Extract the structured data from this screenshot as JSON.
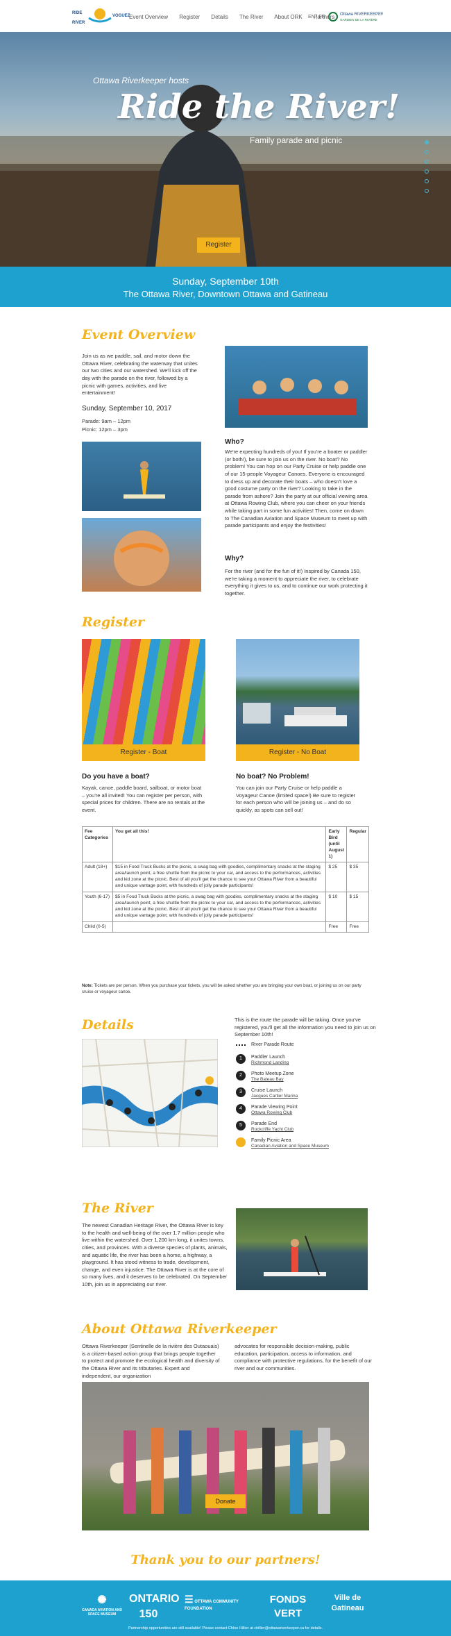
{
  "nav": {
    "logo_text": "RIDE THE RIVER / VOGUEZ SUR LA RIVIÈRE",
    "links": [
      "Event Overview",
      "Register",
      "Details",
      "The River",
      "About ORK",
      "Partners"
    ],
    "lang": "EN | FR",
    "partner_logo": "Ottawa RIVERKEEPER GARDIEN DE LA RIVIÈRE DES OUTAOUAIS"
  },
  "hero": {
    "subtitle": "Ottawa Riverkeeper hosts",
    "title": "Ride the River!",
    "tagline": "Family parade and picnic",
    "button": "Register"
  },
  "dateband": {
    "line1": "Sunday, September 10th",
    "line2": "The Ottawa River, Downtown Ottawa and Gatineau"
  },
  "overview": {
    "heading": "Event Overview",
    "intro": "Join us as we paddle, sail, and motor down the Ottawa River, celebrating the waterway that unites our two cities and our watershed. We'll kick off the day with the parade on the river, followed by a picnic with games, activities, and live entertainment!",
    "date": "Sunday, September 10, 2017",
    "parade": "Parade: 9am – 12pm",
    "picnic": "Picnic: 12pm – 3pm",
    "who_heading": "Who?",
    "who_text": "We're expecting hundreds of you! If you're a boater or paddler (or both!), be sure to join us on the river. No boat? No problem! You can hop on our Party Cruise or help paddle one of our 15-people Voyageur Canoes. Everyone is encouraged to dress up and decorate their boats – who doesn't love a good costume party on the river? Looking to take in the parade from ashore? Join the party at our official viewing area at Ottawa Rowing Club, where you can cheer on your friends while taking part in some fun activities! Then, come on down to The Canadian Aviation and Space Museum to meet up with parade participants and enjoy the festivities!",
    "why_heading": "Why?",
    "why_text": "For the river (and for the fun of it!) Inspired by Canada 150, we're taking a moment to appreciate the river, to celebrate everything it gives to us, and to continue our work protecting it together."
  },
  "register": {
    "heading": "Register",
    "boat_button": "Register - Boat",
    "noboat_button": "Register - No Boat",
    "boat_heading": "Do you have a boat?",
    "boat_text": "Kayak, canoe, paddle board, sailboat, or motor boat – you're all invited! You can register per person, with special prices for children. There are no rentals at the event.",
    "noboat_heading": "No boat? No Problem!",
    "noboat_text": "You can join our Party Cruise or help paddle a Voyageur Canoe (limited space!) Be sure to register for each person who will be joining us – and do so quickly, as spots can sell out!"
  },
  "fees": {
    "headers": [
      "Fee Categories",
      "You get all this!",
      "Early Bird (until August 1)",
      "Regular"
    ],
    "rows": [
      [
        "Adult (18+)",
        "$15 in Food Truck Bucks at the picnic, a swag bag with goodies, complimentary snacks at the staging area/launch point, a free shuttle from the picnic to your car, and access to the performances, activities and kid zone at the picnic. Best of all you'll get the chance to see your Ottawa River from a beautiful and unique vantage point, with hundreds of jolly parade participants!",
        "$ 25",
        "$ 35"
      ],
      [
        "Youth (6-17)",
        "$5 in Food Truck Bucks at the picnic, a swag bag with goodies, complimentary snacks at the staging area/launch point, a free shuttle from the picnic to your car, and access to the performances, activities and kid zone at the picnic. Best of all you'll get the chance to see your Ottawa River from a beautiful and unique vantage point, with hundreds of jolly parade participants!",
        "$ 10",
        "$ 15"
      ],
      [
        "Child (0-5)",
        "",
        "Free",
        "Free"
      ]
    ],
    "note_label": "Note:",
    "note": "Tickets are per person. When you purchase your tickets, you will be asked whether you are bringing your own boat, or joining us on our party cruise or voyageur canoe."
  },
  "details": {
    "heading": "Details",
    "intro": "This is the route the parade will be taking. Once you've registered, you'll get all the information you need to join us on September 10th!",
    "legend_line": "River Parade Route",
    "items": [
      {
        "num": "1",
        "title": "Paddler Launch",
        "place": "Richmond Landing"
      },
      {
        "num": "2",
        "title": "Photo Meetup Zone",
        "place": "The Bateau Bay"
      },
      {
        "num": "3",
        "title": "Cruise Launch",
        "place": "Jacques Cartier Marina"
      },
      {
        "num": "4",
        "title": "Parade Viewing Point",
        "place": "Ottawa Rowing Club"
      },
      {
        "num": "5",
        "title": "Parade End",
        "place": "Rockcliffe Yacht Club"
      },
      {
        "num": "",
        "title": "Family Picnic Area",
        "place": "Canadian Aviation and Space Museum"
      }
    ]
  },
  "river": {
    "heading": "The River",
    "text": "The newest Canadian Heritage River, the Ottawa River is key to the health and well-being of the over 1.7 million people who live within the watershed. Over 1,200 km long, it unites towns, cities, and provinces. With a diverse species of plants, animals, and aquatic life, the river has been a home, a highway, a playground. It has stood witness to trade, development, change, and even injustice. The Ottawa River is at the core of so many lives, and it deserves to be celebrated. On September 10th, join us in appreciating our river."
  },
  "about": {
    "heading": "About Ottawa Riverkeeper",
    "col1": "Ottawa Riverkeeper (Sentinelle de la rivière des Outaouais) is a citizen-based action group that brings people together to protect and promote the ecological health and diversity of the Ottawa River and its tributaries. Expert and independent, our organization",
    "col2": "advocates for responsible decision-making, public education, participation, access to information, and compliance with protective regulations, for the benefit of our river and our communities.",
    "donate": "Donate"
  },
  "partners": {
    "heading": "Thank you to our partners!",
    "logos": [
      "CANADA AVIATION AND SPACE MUSEUM",
      "ONTARIO 150",
      "OTTAWA COMMUNITY FOUNDATION",
      "FONDS VERT",
      "Ville de Gatineau"
    ],
    "footnote": "Partnership opportunities are still available! Please contact Chloe Hillier at chillier@ottawariverkeeper.ca for details."
  },
  "colors": {
    "accent": "#f3b31d",
    "band": "#1fa1cf"
  }
}
